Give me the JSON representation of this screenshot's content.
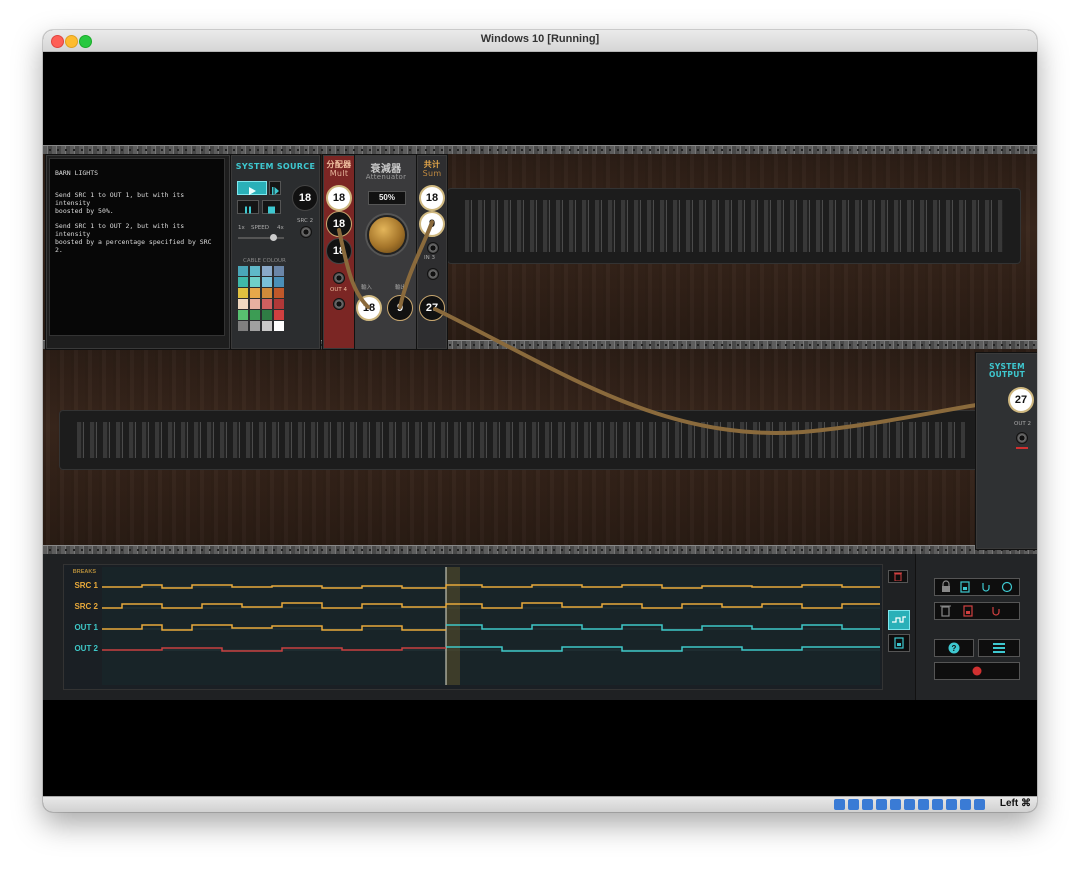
{
  "window": {
    "title": "Windows 10 [Running]"
  },
  "statusbar": {
    "host_key": "Left ⌘",
    "icons": [
      "storage-icon",
      "optical-icon",
      "usb-icon",
      "shared-folder-icon",
      "pencil-icon",
      "display-icon",
      "network-icon",
      "capture-icon",
      "cpu-icon",
      "globe-icon",
      "download-icon"
    ]
  },
  "terminal": {
    "title": "BARN LIGHTS",
    "line1": "Send SRC 1 to OUT 1, but with its intensity\nboosted by 50%.",
    "line2": "Send SRC 1 to OUT 2, but with its intensity\nboosted by a percentage specified by SRC 2."
  },
  "system_source": {
    "title": "SYSTEM SOURCE",
    "src1_value": "18",
    "src2_label": "SRC 2",
    "speed_label": "SPEED",
    "speed_min": "1x",
    "speed_max": "4x",
    "cable_colour_label": "CABLE COLOUR",
    "swatch_colors": [
      "#4aa6b8",
      "#5fb8c8",
      "#8aa9c9",
      "#6b86a8",
      "#3fb8a8",
      "#6fd0c8",
      "#7bc0d8",
      "#4a8fb8",
      "#e0c040",
      "#e6a84a",
      "#d08a3a",
      "#c0582a",
      "#f0d8c0",
      "#e8b0a0",
      "#d06060",
      "#b03838",
      "#58c070",
      "#3c9c54",
      "#2f7c44",
      "#d04040",
      "#808080",
      "#a0a0a0",
      "#c8c8c8",
      "#ffffff"
    ]
  },
  "mult": {
    "title_cn": "分配器",
    "title": "Mult",
    "in_value": "18",
    "out1_value": "18",
    "out2_value": "18",
    "out3_label": "OUT 3",
    "out4_label": "OUT 4"
  },
  "attenuator": {
    "title_cn": "衰減器",
    "title": "Attenuator",
    "percent": "50%",
    "in_label": "輸入",
    "out_label": "輸出",
    "in_value": "18",
    "out_value": "9"
  },
  "sum": {
    "title_cn": "共计",
    "title": "Sum",
    "in1_value": "18",
    "in2_value": "9",
    "in3_label": "IN 3",
    "out_value": "27"
  },
  "system_output": {
    "title": "SYSTEM OUTPUT",
    "out1_value": "27",
    "out2_label": "OUT 2"
  },
  "timeline": {
    "breaks_label": "BREAKS",
    "rows": [
      {
        "label": "SRC 1",
        "color": "#e8a93a"
      },
      {
        "label": "SRC 2",
        "color": "#e8a93a"
      },
      {
        "label": "OUT 1",
        "color": "#e8a93a"
      },
      {
        "label": "OUT 2",
        "color": "#3ec8c8"
      }
    ]
  },
  "colors": {
    "accent_teal": "#2ab0b8",
    "cable": "#8a6a3c",
    "mult_red": "#8e2a28"
  }
}
